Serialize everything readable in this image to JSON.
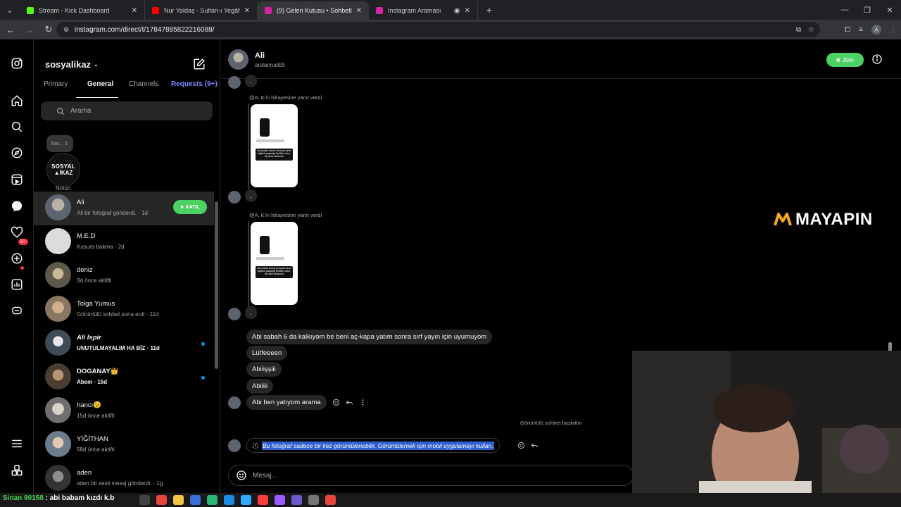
{
  "browser": {
    "tabs": [
      {
        "title": "Stream - Kick Dashboard",
        "favicon_color": "#53fc18",
        "active": false
      },
      {
        "title": "Nur Yoldaş - Sultan-ı Yegâh (Of",
        "favicon_color": "#ff0000",
        "active": false
      },
      {
        "title": "(9) Gelen Kutusu • Sohbetler",
        "favicon_color": "#d6249f",
        "active": true
      },
      {
        "title": "Instagram Araması",
        "favicon_color": "#d6249f",
        "active": false
      }
    ],
    "url": "instagram.com/direct/t/17847885822216088/",
    "profile_initial": "A"
  },
  "rail": {
    "icons": [
      "instagram-logo-icon",
      "home-icon",
      "search-icon",
      "explore-icon",
      "reels-icon",
      "messenger-icon",
      "heart-icon",
      "create-icon",
      "dashboard-icon",
      "threads-icon",
      "menu-icon",
      "more-icon"
    ],
    "messages_badge": "9+"
  },
  "inbox": {
    "account_name": "sosyalikaz",
    "tabs": [
      "Primary",
      "General",
      "Channels",
      "Requests (9+)"
    ],
    "active_tab": "General",
    "search_placeholder": "Arama",
    "note_bubble": "Not...",
    "note_avatar_line1": "SOSYAL",
    "note_avatar_line2": "▲İKAZ",
    "note_label": "Notun",
    "threads": [
      {
        "name": "Ali",
        "sub": "Ali bir fotoğraf gönderdi. · 1d",
        "selected": true,
        "join_label": "KATIL",
        "unread": false,
        "bold": false,
        "avatar_color": "#6b6f6a"
      },
      {
        "name": "M.E.D",
        "sub": "Kusura bakma · 2d",
        "selected": false,
        "unread": false,
        "bold": false,
        "avatar_color": "#dbdbdb"
      },
      {
        "name": "deniz",
        "sub": "3d önce aktifti",
        "selected": false,
        "unread": false,
        "bold": false,
        "avatar_color": "#8a7d62"
      },
      {
        "name": "Tolga Yumus",
        "sub": "Görüntülü sohbet sona erdi · 11d",
        "selected": false,
        "unread": false,
        "bold": false,
        "avatar_color": "#a89478"
      },
      {
        "name": "Ali Ispir",
        "sub": "UNUTULMAYALIM HA BİZ · 11d",
        "selected": false,
        "unread": true,
        "bold": true,
        "avatar_color": "#4d5b68"
      },
      {
        "name": "DOGANAY👑",
        "sub": "Abem · 16d",
        "selected": false,
        "unread": true,
        "bold": true,
        "avatar_color": "#6b5a48"
      },
      {
        "name": "hancı😉",
        "sub": "15d önce aktifti",
        "selected": false,
        "unread": false,
        "bold": false,
        "avatar_color": "#9a9a9a"
      },
      {
        "name": "YİĞİTHAN",
        "sub": "58d önce aktifti",
        "selected": false,
        "unread": false,
        "bold": false,
        "avatar_color": "#7d8a94"
      },
      {
        "name": "aden",
        "sub": "aden bir sesli mesaj gönderdi. · 1g",
        "selected": false,
        "unread": false,
        "bold": false,
        "avatar_color": "#555"
      }
    ]
  },
  "chat": {
    "contact_name": "Ali",
    "contact_username": "arslannali55",
    "join_label": "Join",
    "story_reply_label": "@A. K'in hikayesine yanıt verdi",
    "story_text": "Normalde aranız olmayan ama bağlılık yaşadığı farklılık olsun, hiç ama sarsıcıdır",
    "dot_text": ".",
    "messages": [
      "Abi sabah 6 da kalkıyom be beni aç-kapa yatım sonra sırf yayın için uyumuyom",
      "Lütfeeeen",
      "Abiiişşiii",
      "Abiiiii",
      "Abi ben yatıyom arama"
    ],
    "system_message": "Görüntülü sohbet başlattın",
    "photo_message": "Bu fotoğraf sadece bir kez görüntülenebilir. Görüntülemek için mobil uygulamayı kullan.",
    "composer_placeholder": "Mesaj..."
  },
  "overlay": {
    "logo_text": "MAYAPIN",
    "ticker_name": "Sinan 90158",
    "ticker_text": ": abi babam kızdı k.b"
  },
  "colors": {
    "accent_green": "#4cd263",
    "link_blue": "#0095f6",
    "requests": "#7f87ff",
    "badge_red": "#ff3040"
  }
}
